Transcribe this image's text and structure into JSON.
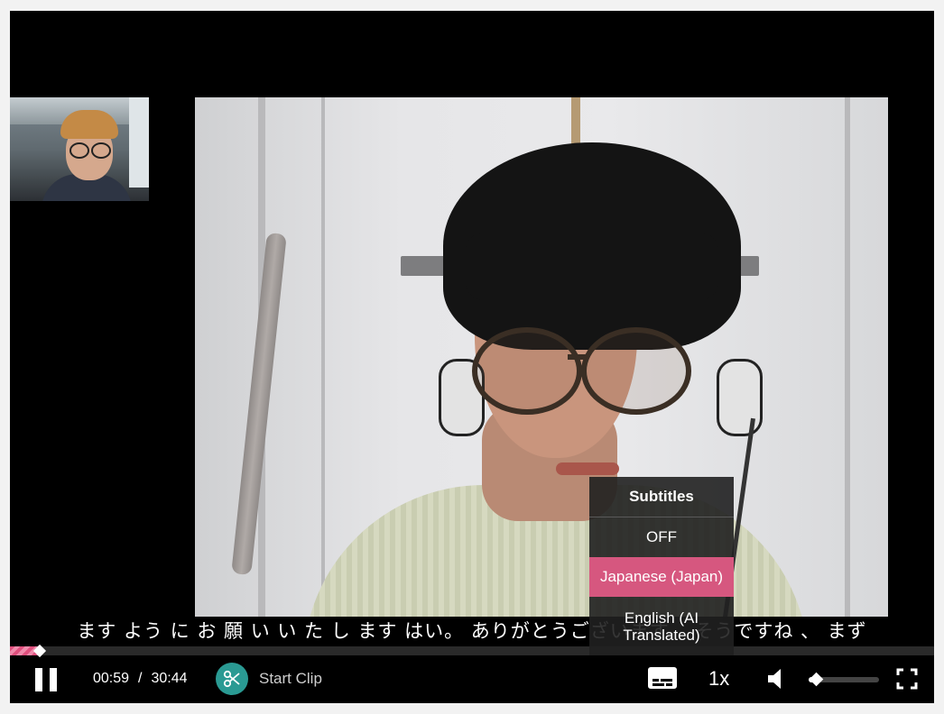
{
  "caption": "ます よう に お 願 い い た し ます はい。 ありがとうございます。 そうですね 、 まず",
  "player": {
    "progress_fraction": 0.032,
    "volume_fraction": 0.1,
    "accent_color": "#d6577f",
    "clip_color": "#2a9a93"
  },
  "controls": {
    "current_time": "00:59",
    "separator": "/",
    "duration": "30:44",
    "clip_label": "Start Clip",
    "speed": "1x"
  },
  "subtitles_menu": {
    "title": "Subtitles",
    "options": [
      {
        "label": "OFF",
        "selected": false
      },
      {
        "label": "Japanese (Japan)",
        "selected": true
      },
      {
        "label": "English (AI Translated)",
        "selected": false
      }
    ]
  },
  "icons": {
    "pause": "pause-icon",
    "clip": "scissors-icon",
    "subtitles": "closed-captions-icon",
    "volume": "speaker-icon",
    "fullscreen": "fullscreen-icon"
  }
}
